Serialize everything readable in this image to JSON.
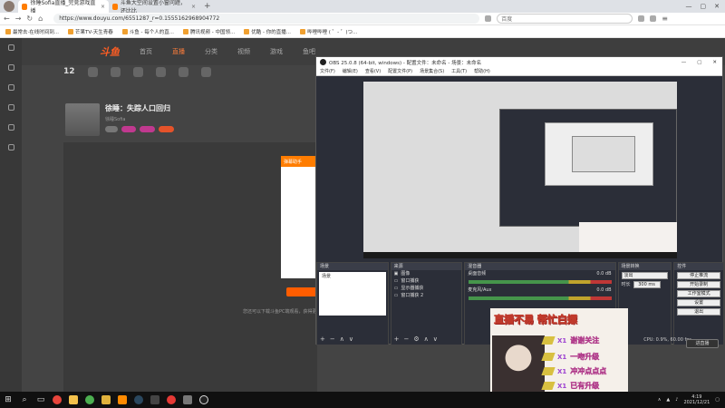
{
  "browser": {
    "tabs": [
      {
        "label": "徐睡Sofia直播_完竞游戏直播_",
        "active": true
      },
      {
        "label": "斗鱼大空间设置小窗问题，还比比",
        "active": false
      }
    ],
    "url": "https://www.douyu.com/6551287_r=0.1555162968904772",
    "search_text": "百度",
    "bookmarks": [
      "最常去·在线时间到...",
      "芒果TV-天生青春",
      "斗鱼 - 每个人的直...",
      "腾讯视频 - 中国领...",
      "优酷 - 你的直播...",
      "哔哩哔哩 ( ゜- ゜)つ..."
    ]
  },
  "douyu": {
    "logo": "斗鱼",
    "nav": [
      "首页",
      "直播",
      "分类",
      "视频",
      "游戏",
      "鱼吧"
    ],
    "follow_count": "12",
    "anchor_name": "徐睡：失踪人口回归",
    "anchor_sub": "徐睡Sofia",
    "popup_title": "弹幕助手",
    "play_hint": "您还可以下载斗鱼PC端观看，获得更好体验"
  },
  "obs": {
    "title": "OBS 25.0.8 (64-bit, windows) - 配置文件：未命名 - 场景：未命名",
    "menu": [
      "文件(F)",
      "编辑(E)",
      "查看(V)",
      "配置文件(P)",
      "场景集合(S)",
      "工具(T)",
      "帮助(H)"
    ],
    "docks": {
      "scenes": "场景",
      "sources": "来源",
      "mixer": "混音器",
      "transitions": "场景转换",
      "controls": "控件"
    },
    "scene_items": [
      "场景"
    ],
    "source_items": [
      "图像",
      "窗口捕获",
      "显示器捕获",
      "窗口捕获 2"
    ],
    "mixer_items": [
      {
        "name": "桌面音频",
        "db": "0.0 dB"
      },
      {
        "name": "麦克风/Aux",
        "db": "0.0 dB"
      }
    ],
    "transition": "淡出",
    "duration_label": "时长",
    "duration_value": "300 ms",
    "control_buttons": [
      "停止推流",
      "开始录制",
      "工作室模式",
      "设置",
      "退出"
    ],
    "status": "CPU: 0.9%, 60.00 fps"
  },
  "overlay": {
    "title": "直播不易 帮忙白嫖",
    "rows": [
      {
        "mult": "X1",
        "text": "谢谢关注"
      },
      {
        "mult": "X1",
        "text": "一吻升级"
      },
      {
        "mult": "X1",
        "text": "冲冲点点点"
      },
      {
        "mult": "X1",
        "text": "已有升级"
      }
    ],
    "badge": "进直播"
  },
  "taskbar": {
    "time": "4:19",
    "date": "2021/12/21"
  }
}
